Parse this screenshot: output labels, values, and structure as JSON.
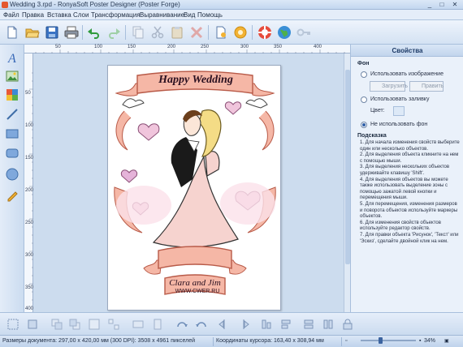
{
  "window": {
    "title": "Wedding 3.rpd - RonyaSoft Poster Designer (Poster Forge)",
    "controls": [
      "_",
      "□",
      "✕"
    ]
  },
  "menu": [
    "Файл",
    "Правка",
    "Вставка",
    "Слои",
    "Трансформация",
    "Выравнивание",
    "Вид",
    "Помощь"
  ],
  "toolbar_icons": [
    "new-icon",
    "open-icon",
    "save-icon",
    "print-icon",
    "undo-icon",
    "redo-icon",
    "copy-icon",
    "cut-icon",
    "paste-icon",
    "delete-icon",
    "page-settings-icon",
    "settings-icon",
    "help-icon",
    "web-icon",
    "key-icon"
  ],
  "left_tools": [
    "text-tool-icon",
    "image-tool-icon",
    "clipart-tool-icon",
    "line-tool-icon",
    "rectangle-tool-icon",
    "rounded-rectangle-tool-icon",
    "ellipse-tool-icon",
    "pencil-tool-icon"
  ],
  "ruler_h": [
    "50",
    "100",
    "150",
    "200",
    "250",
    "300",
    "350",
    "400"
  ],
  "ruler_v": [
    "50",
    "100",
    "150",
    "200",
    "250",
    "300",
    "350",
    "400"
  ],
  "poster": {
    "banner_top": "Happy Wedding",
    "banner_bottom": "Clara and Jim",
    "watermark": "WWW.CWER.RU",
    "colors": {
      "pink": "#f5b7a6",
      "lilac": "#e5b3d9",
      "heart": "#f0c5dc",
      "dress": "#f6d3cf",
      "hair": "#f4dc86",
      "suit": "#1a1a1a"
    }
  },
  "panel": {
    "title": "Свойства",
    "background_heading": "Фон",
    "use_image": "Использовать изображение",
    "load_button": "Загрузить",
    "edit_button": "Править",
    "use_fill": "Использовать заливку",
    "color_label": "Цвет:",
    "no_background": "Не использовать фон",
    "hint_heading": "Подсказка",
    "hints": [
      "1. Для начала изменения свойств выберите один или несколько объектов.",
      "2. Для выделения объекта кликните на нем с помощью мыши.",
      "3. Для выделения нескольких объектов удерживайте клавишу 'Shift'.",
      "4. Для выделения объектов вы можете также использовать выделение зоны с помощью зажатой левой кнопки и перемещения мыши.",
      "5. Для перемещения, изменения размеров и поворота объектов используйте маркеры объектов.",
      "6. Для изменения свойств объектов используйте редактор свойств.",
      "7. Для правки объекта 'Рисунок', 'Текст' или 'Эскиз', сделайте двойной клик на нем."
    ]
  },
  "bottom_tools": [
    "align-left-icon",
    "align-top-icon",
    "bring-front-icon",
    "send-back-icon",
    "group-icon",
    "ungroup-icon",
    "rotate-left-icon",
    "rotate-right-icon",
    "flip-h-icon",
    "flip-v-icon",
    "align-center-icon",
    "align-middle-icon",
    "distribute-h-icon",
    "distribute-v-icon",
    "same-width-icon",
    "same-height-icon",
    "lock-icon"
  ],
  "status": {
    "doc_size": "Размеры документа: 297,00 x 420,00 мм (300 DPI): 3508 x 4961 пикселей",
    "cursor": "Координаты курсора: 163,40 x 308,94 мм",
    "zoom": "34%"
  }
}
